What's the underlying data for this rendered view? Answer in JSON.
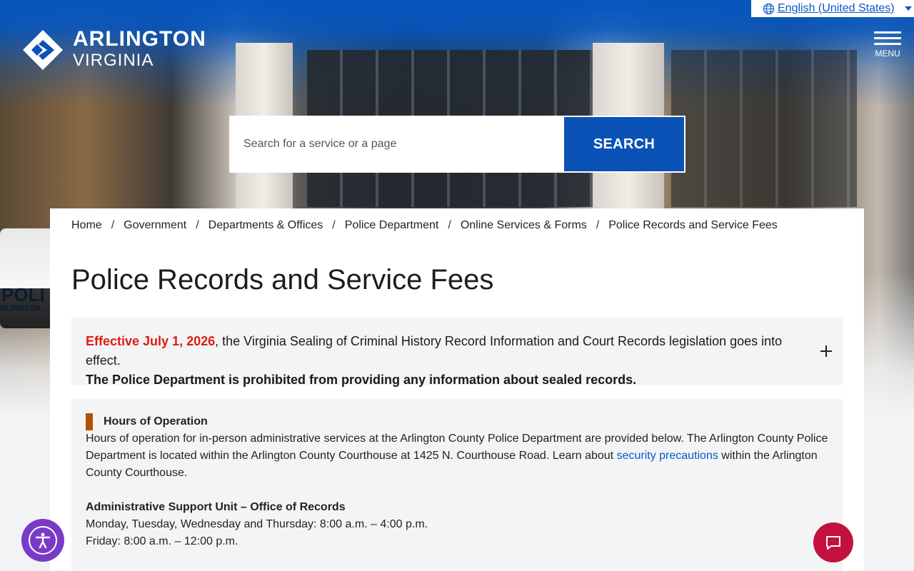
{
  "header": {
    "language": "English (United States)",
    "logo": {
      "line1": "ARLINGTON",
      "line2": "VIRGINIA"
    },
    "menu_label": "MENU"
  },
  "search": {
    "placeholder": "Search for a service or a page",
    "button_label": "SEARCH"
  },
  "hero_car": {
    "text1": "POLI",
    "text2": "RLINGTON"
  },
  "breadcrumb": {
    "items": [
      "Home",
      "Government",
      "Departments & Offices",
      "Police Department",
      "Online Services & Forms",
      "Police Records and Service Fees"
    ],
    "separator": "/"
  },
  "page_title": "Police Records and Service Fees",
  "alert": {
    "lead_icon": "",
    "effective": "Effective July 1, 2026",
    "text": ", the Virginia Sealing of Criminal History Record Information and Court Records legislation goes into effect.",
    "bold": "The Police Department is prohibited from providing any information about sealed records.",
    "trail_icon": ""
  },
  "hours": {
    "heading": "Hours of Operation",
    "intro_before_link": "Hours of operation for in-person administrative services at the Arlington County Police Department are provided below. The Arlington County Police Department is located within the Arlington County Courthouse at 1425 N. Courthouse Road. Learn about ",
    "link": "security precautions",
    "intro_after_link": " within the Arlington County Courthouse.",
    "unit": "Administrative Support Unit – Office of Records",
    "schedule": [
      "Monday, Tuesday, Wednesday and Thursday: 8:00 a.m. – 4:00 p.m.",
      "Friday: 8:00 a.m. – 12:00 p.m."
    ]
  },
  "colors": {
    "brand_blue": "#0a52b5",
    "alert_red": "#e01b12",
    "accent_orange": "#b25200",
    "chat_red": "#c2113f",
    "a11y_purple": "#7a3ac8"
  },
  "icons": [
    "globe-icon",
    "chevron-down-icon",
    "logo-mark-icon",
    "hamburger-icon",
    "plus-icon",
    "accessibility-icon",
    "chat-icon"
  ]
}
